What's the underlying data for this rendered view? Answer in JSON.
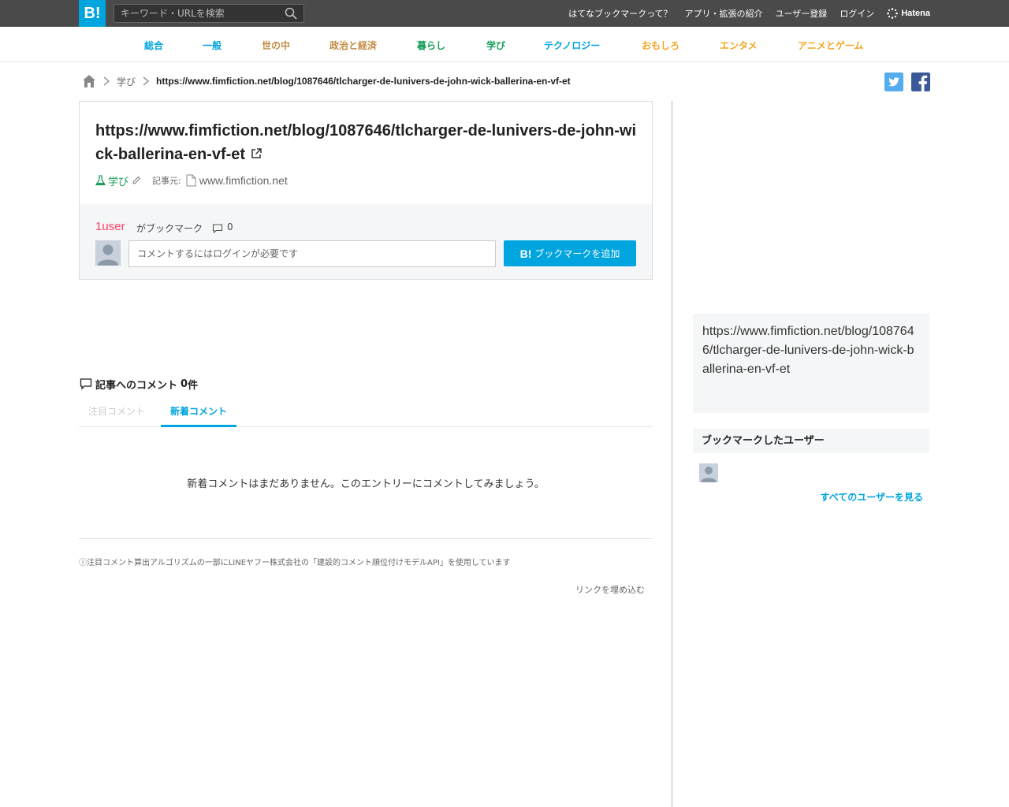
{
  "header": {
    "logo": "B!",
    "search_placeholder": "キーワード・URLを検索",
    "links": [
      "はてなブックマークって？",
      "アプリ・拡張の紹介",
      "ユーザー登録",
      "ログイン"
    ],
    "brand": "Hatena"
  },
  "categories": [
    {
      "label": "総合",
      "color": "#00a4de"
    },
    {
      "label": "一般",
      "color": "#00a4de"
    },
    {
      "label": "世の中",
      "color": "#c38c43"
    },
    {
      "label": "政治と経済",
      "color": "#c38c43"
    },
    {
      "label": "暮らし",
      "color": "#1a9f5a"
    },
    {
      "label": "学び",
      "color": "#1a9f5a"
    },
    {
      "label": "テクノロジー",
      "color": "#00a4de"
    },
    {
      "label": "おもしろ",
      "color": "#f5a623"
    },
    {
      "label": "エンタメ",
      "color": "#f5a623"
    },
    {
      "label": "アニメとゲーム",
      "color": "#f5a623"
    }
  ],
  "breadcrumb": {
    "category": "学び",
    "current": "https://www.fimfiction.net/blog/1087646/tlcharger-de-lunivers-de-john-wick-ballerina-en-vf-et"
  },
  "entry": {
    "title": "https://www.fimfiction.net/blog/1087646/tlcharger-de-lunivers-de-john-wick-ballerina-en-vf-et",
    "category": "学び",
    "source_label": "記事元:",
    "domain": "www.fimfiction.net",
    "users_count": "1user",
    "bookmark_label": "がブックマーク",
    "comment_count": "0",
    "comment_placeholder": "コメントするにはログインが必要です",
    "add_button_logo": "B!",
    "add_button_label": "ブックマークを追加"
  },
  "comments": {
    "heading": "記事へのコメント",
    "count": "0",
    "count_suffix": "件",
    "tabs": [
      "注目コメント",
      "新着コメント"
    ],
    "empty_message": "新着コメントはまだありません。このエントリーにコメントしてみましょう。",
    "algorithm_note": "ⓘ注目コメント算出アルゴリズムの一部にLINEヤフー株式会社の「建設的コメント順位付けモデルAPI」を使用しています",
    "embed_link": "リンクを埋め込む"
  },
  "sidebar": {
    "url_text": "https://www.fimfiction.net/blog/1087646/tlcharger-de-lunivers-de-john-wick-ballerina-en-vf-et",
    "users_heading": "ブックマークしたユーザー",
    "all_users_link": "すべてのユーザーを見る"
  },
  "colors": {
    "brand": "#00a4de",
    "topbar": "#4a4a4a",
    "users_count": "#ff4166",
    "twitter": "#55acee",
    "facebook": "#3b5998"
  }
}
